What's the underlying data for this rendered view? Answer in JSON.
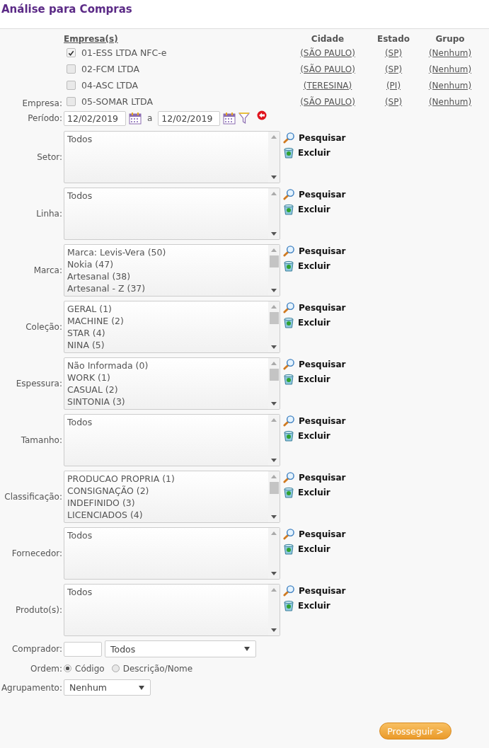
{
  "title": "Análise para Compras",
  "companies": {
    "label": "Empresa:",
    "columns": [
      "Empresa(s)",
      "Cidade",
      "Estado",
      "Grupo"
    ],
    "rows": [
      {
        "name": "01-ESS LTDA NFC-e",
        "checked": true,
        "city": "(SÃO PAULO)",
        "state": "(SP)",
        "group": "(Nenhum)"
      },
      {
        "name": "02-FCM LTDA",
        "checked": false,
        "city": "(SÃO PAULO)",
        "state": "(SP)",
        "group": "(Nenhum)"
      },
      {
        "name": "04-ASC LTDA",
        "checked": false,
        "city": "(TERESINA)",
        "state": "(PI)",
        "group": "(Nenhum)"
      },
      {
        "name": "05-SOMAR LTDA",
        "checked": false,
        "city": "(SÃO PAULO)",
        "state": "(SP)",
        "group": "(Nenhum)"
      }
    ]
  },
  "period": {
    "label": "Período:",
    "from": "12/02/2019",
    "separator": "a",
    "to": "12/02/2019"
  },
  "lists": [
    {
      "label": "Setor:",
      "items": [
        "Todos"
      ],
      "search": "Pesquisar",
      "remove": "Excluir"
    },
    {
      "label": "Linha:",
      "items": [
        "Todos"
      ],
      "search": "Pesquisar",
      "remove": "Excluir"
    },
    {
      "label": "Marca:",
      "items": [
        "Marca: Levis-Vera (50)",
        "Nokia (47)",
        "Artesanal (38)",
        "Artesanal - Z (37)"
      ],
      "search": "Pesquisar",
      "remove": "Excluir"
    },
    {
      "label": "Coleção:",
      "items": [
        "GERAL (1)",
        "MACHINE (2)",
        "STAR (4)",
        "NINA (5)"
      ],
      "search": "Pesquisar",
      "remove": "Excluir"
    },
    {
      "label": "Espessura:",
      "items": [
        "Não Informada (0)",
        "WORK (1)",
        "CASUAL (2)",
        "SINTONIA (3)"
      ],
      "search": "Pesquisar",
      "remove": "Excluir"
    },
    {
      "label": "Tamanho:",
      "items": [
        "Todos"
      ],
      "search": "Pesquisar",
      "remove": "Excluir"
    },
    {
      "label": "Classificação:",
      "items": [
        "PRODUCAO PROPRIA (1)",
        "CONSIGNAÇÃO (2)",
        "INDEFINIDO (3)",
        "LICENCIADOS (4)"
      ],
      "search": "Pesquisar",
      "remove": "Excluir"
    },
    {
      "label": "Fornecedor:",
      "items": [
        "Todos"
      ],
      "search": "Pesquisar",
      "remove": "Excluir"
    },
    {
      "label": "Produto(s):",
      "items": [
        "Todos"
      ],
      "search": "Pesquisar",
      "remove": "Excluir"
    }
  ],
  "buyer": {
    "label": "Comprador:",
    "select": "Todos"
  },
  "order": {
    "label": "Ordem:",
    "options": [
      {
        "label": "Código",
        "selected": true
      },
      {
        "label": "Descrição/Nome",
        "selected": false
      }
    ]
  },
  "grouping": {
    "label": "Agrupamento:",
    "value": "Nenhum"
  },
  "submit": "Prosseguir >"
}
